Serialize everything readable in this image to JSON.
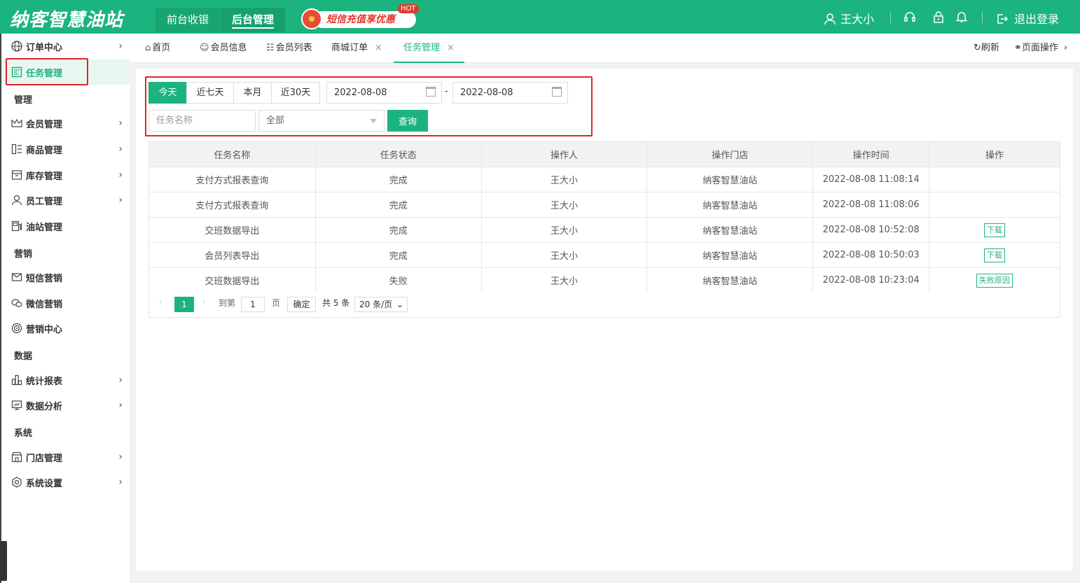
{
  "header": {
    "logo": "纳客智慧油站",
    "tabs": [
      "前台收银",
      "后台管理"
    ],
    "promo_text": "短信充值享优惠",
    "promo_hot": "HOT",
    "user_name": "王大小",
    "logout_label": "退出登录",
    "accent_color": "#1cb47e"
  },
  "sidebar": {
    "items": [
      {
        "label": "订单中心",
        "icon": "globe-icon"
      },
      {
        "label": "任务管理",
        "icon": "task-icon"
      },
      {
        "label": "会员管理",
        "icon": "crown-icon"
      },
      {
        "label": "商品管理",
        "icon": "goods-icon"
      },
      {
        "label": "库存管理",
        "icon": "inventory-icon"
      },
      {
        "label": "员工管理",
        "icon": "person-icon"
      },
      {
        "label": "油站管理",
        "icon": "fuel-icon"
      },
      {
        "label": "短信营销",
        "icon": "mail-icon"
      },
      {
        "label": "微信营销",
        "icon": "wechat-icon"
      },
      {
        "label": "营销中心",
        "icon": "target-icon"
      },
      {
        "label": "统计报表",
        "icon": "bar-chart-icon"
      },
      {
        "label": "数据分析",
        "icon": "monitor-chart-icon"
      },
      {
        "label": "门店管理",
        "icon": "store-icon"
      },
      {
        "label": "系统设置",
        "icon": "gear-icon"
      }
    ],
    "sections": [
      "管理",
      "营销",
      "数据",
      "系统"
    ]
  },
  "tabs": {
    "items": [
      "首页",
      "会员信息",
      "会员列表",
      "商城订单",
      "任务管理"
    ],
    "refresh_label": "刷新",
    "page_ops_label": "页面操作"
  },
  "filter": {
    "quick_ranges": [
      "今天",
      "近七天",
      "本月",
      "近30天"
    ],
    "start_date": "2022-08-08",
    "end_date": "2022-08-08",
    "separator": "-",
    "task_name_placeholder": "任务名称",
    "status_selected": "全部",
    "query_label": "查询"
  },
  "table": {
    "columns": [
      "任务名称",
      "任务状态",
      "操作人",
      "操作门店",
      "操作时间",
      "操作"
    ],
    "rows": [
      {
        "name": "支付方式报表查询",
        "status": "完成",
        "operator": "王大小",
        "store": "纳客智慧油站",
        "time": "2022-08-08 11:08:14",
        "action": ""
      },
      {
        "name": "支付方式报表查询",
        "status": "完成",
        "operator": "王大小",
        "store": "纳客智慧油站",
        "time": "2022-08-08 11:08:06",
        "action": ""
      },
      {
        "name": "交班数据导出",
        "status": "完成",
        "operator": "王大小",
        "store": "纳客智慧油站",
        "time": "2022-08-08 10:52:08",
        "action": "下载"
      },
      {
        "name": "会员列表导出",
        "status": "完成",
        "operator": "王大小",
        "store": "纳客智慧油站",
        "time": "2022-08-08 10:50:03",
        "action": "下载"
      },
      {
        "name": "交班数据导出",
        "status": "失败",
        "operator": "王大小",
        "store": "纳客智慧油站",
        "time": "2022-08-08 10:23:04",
        "action": "失败原因"
      }
    ]
  },
  "pager": {
    "current_page": "1",
    "goto_label": "到第",
    "goto_value": "1",
    "page_unit": "页",
    "confirm_label": "确定",
    "total_label": "共 5 条",
    "page_size": "20 条/页"
  }
}
